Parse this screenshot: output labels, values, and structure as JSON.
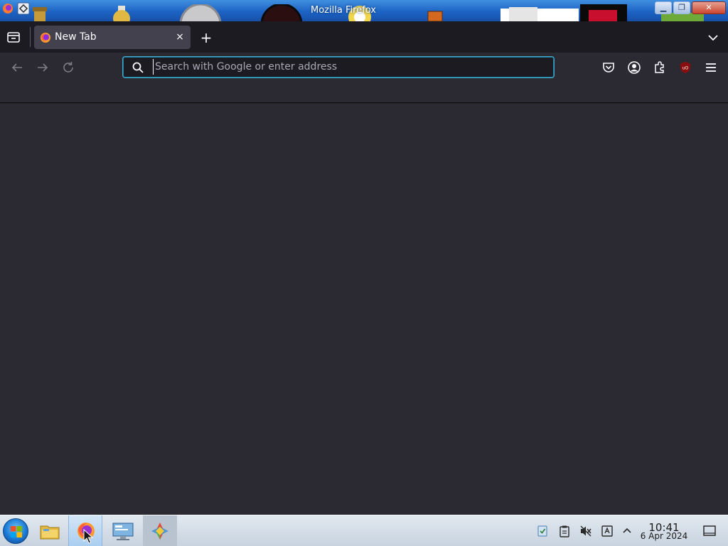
{
  "window": {
    "title": "Mozilla Firefox",
    "minimize_label": "▁",
    "maximize_label": "❐",
    "close_label": "✕"
  },
  "tabs": [
    {
      "label": "New Tab",
      "close_label": "×"
    }
  ],
  "tabstrip": {
    "new_tab_label": "+"
  },
  "urlbar": {
    "placeholder": "Search with Google or enter address",
    "value": ""
  },
  "taskbar": {
    "apps": [
      "start-menu",
      "file-manager",
      "firefox",
      "network-settings",
      "app-launcher"
    ],
    "clock": {
      "time": "10:41",
      "date": "6 Apr 2024"
    }
  },
  "colors": {
    "content_bg": "#2b2a33",
    "tab_bg": "#42414d",
    "urlbar_focus": "#4aa6c6"
  }
}
